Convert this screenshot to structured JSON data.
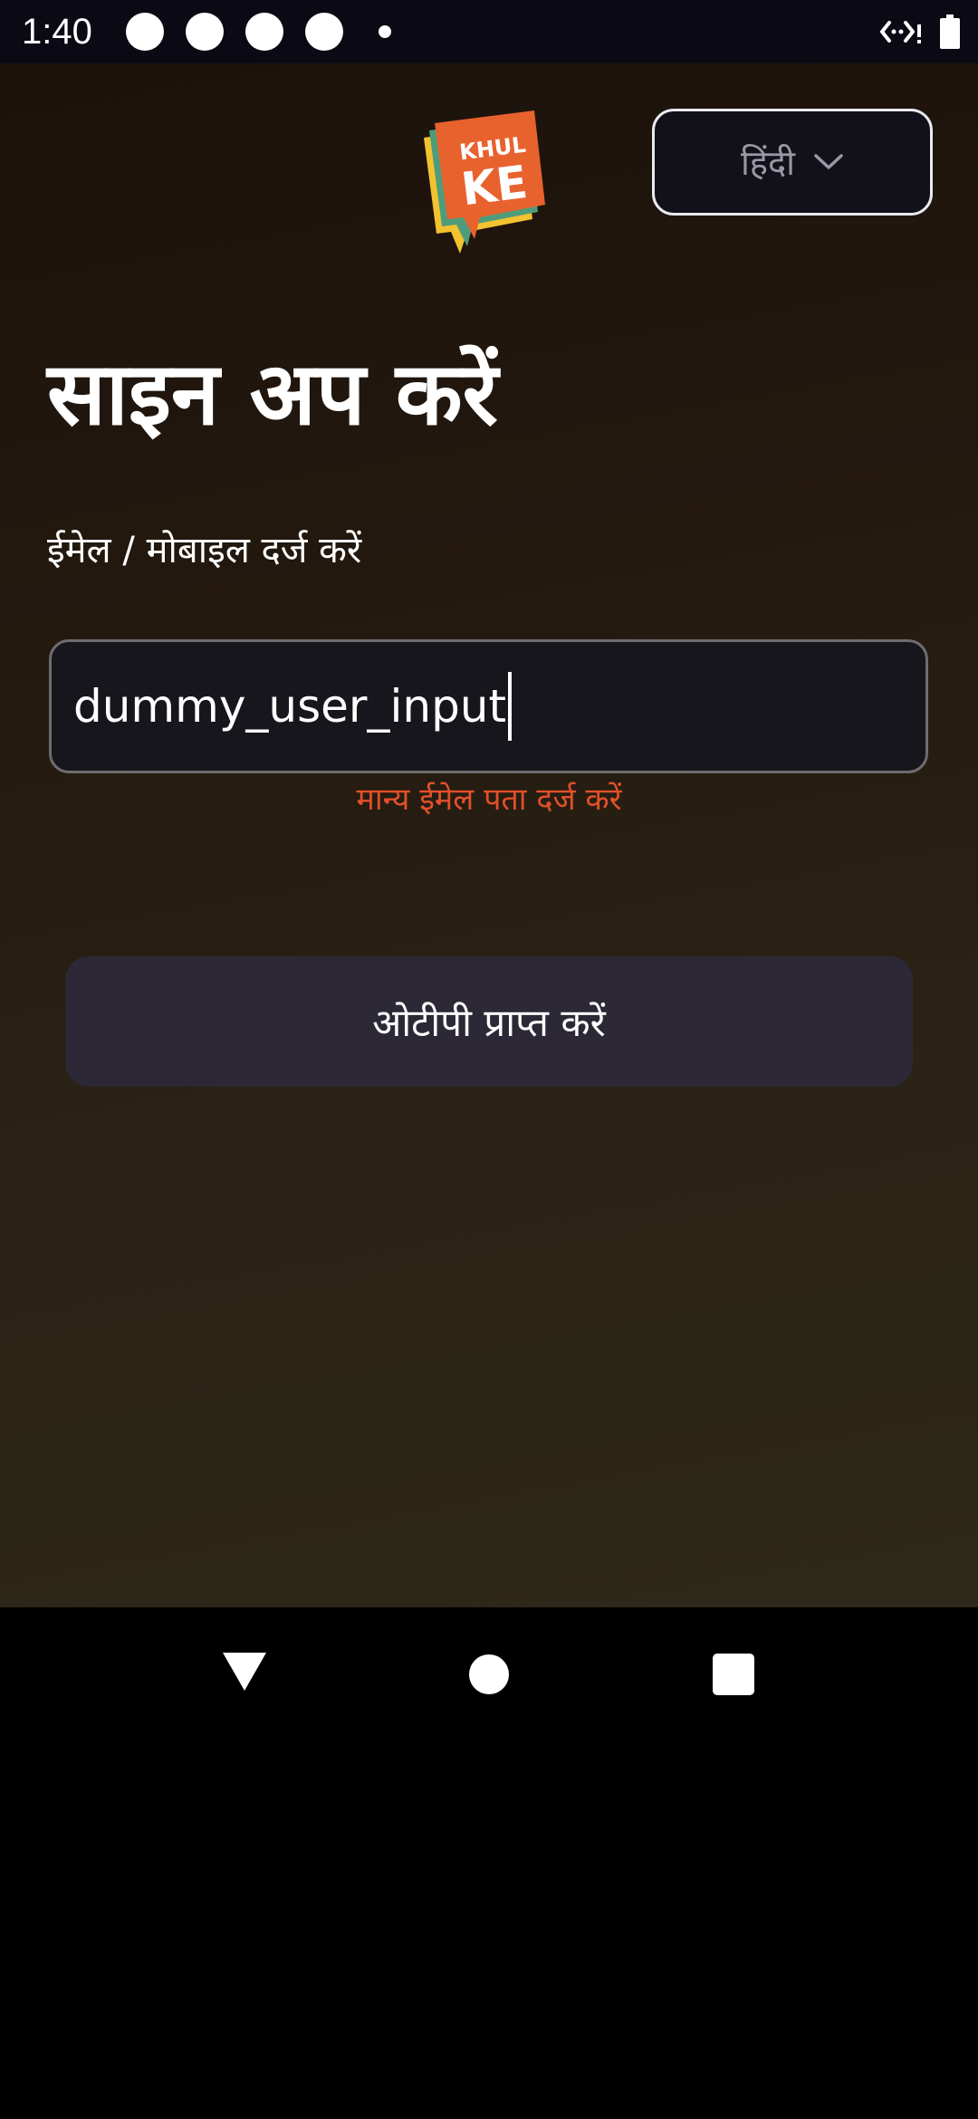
{
  "status_bar": {
    "time": "1:40",
    "icons": [
      "notification-dot-icon",
      "notification-dot-icon",
      "notification-dot-icon",
      "notification-dot-icon",
      "small-dot-icon",
      "data-saver-icon",
      "battery-icon"
    ]
  },
  "header": {
    "logo_text_top": "KHUL",
    "logo_text_bottom": "KE",
    "language_selector": {
      "label": "हिंदी",
      "icon": "chevron-down-icon"
    }
  },
  "main": {
    "title": "साइन अप करें",
    "field_label": "ईमेल / मोबाइल दर्ज करें",
    "input_value": "dummy_user_input",
    "error_message": "मान्य ईमेल पता दर्ज करें",
    "submit_label": "ओटीपी प्राप्त करें"
  },
  "nav_bar": {
    "icons": [
      "back-icon",
      "home-icon",
      "recents-icon"
    ]
  },
  "colors": {
    "error": "#e2502a",
    "button_bg": "#2c2835",
    "logo_orange": "#e8622e"
  }
}
